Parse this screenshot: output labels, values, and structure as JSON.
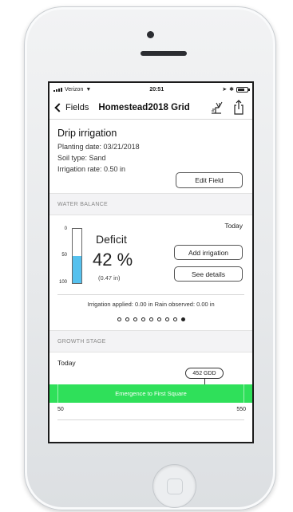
{
  "status_bar": {
    "carrier": "Verizon",
    "time": "20:51"
  },
  "nav": {
    "back_label": "Fields",
    "title": "Homestead2018 Grid"
  },
  "field": {
    "name": "Drip irrigation",
    "planting_date": "Planting date: 03/21/2018",
    "soil_type": "Soil type: Sand",
    "irrigation_rate": "Irrigation rate: 0.50 in",
    "edit_button": "Edit Field"
  },
  "water_balance": {
    "header": "WATER BALANCE",
    "date_label": "Today",
    "gauge_ticks": [
      "0",
      "50",
      "100"
    ],
    "gauge_fill_fraction": 0.5,
    "status_label": "Deficit",
    "percent": "42 %",
    "amount": "(0.47 in)",
    "add_irrigation_button": "Add irrigation",
    "details_button": "See details",
    "summary": "Irrigation applied: 0.00 in  Rain observed: 0.00 in",
    "fill_color": "#56c1ee"
  },
  "pager": {
    "total": 9,
    "active_index": 8
  },
  "growth_stage": {
    "header": "GROWTH STAGE",
    "date_label": "Today",
    "gdd_badge": "452 GDD",
    "stage_label": "Emergence to First Square",
    "scale_min": "50",
    "scale_max": "550",
    "bar_color": "#2fe05a"
  }
}
